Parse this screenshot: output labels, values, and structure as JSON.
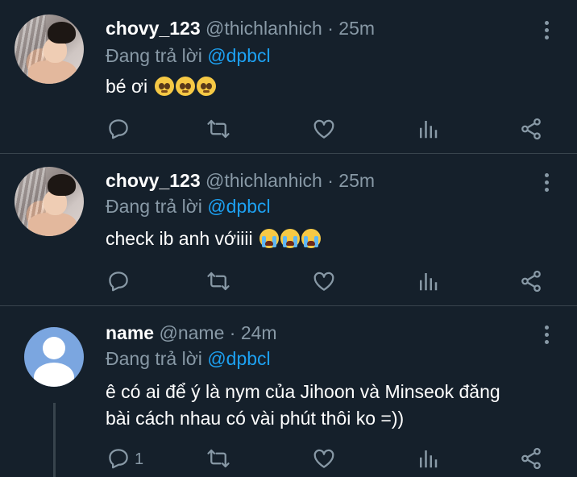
{
  "tweets": [
    {
      "name": "chovy_123",
      "handle": "@thichlanhich",
      "time": "· 25m",
      "reply_prefix": "Đang trả lời",
      "reply_to": "@dpbcl",
      "text": "bé ơi",
      "emoji": [
        "pleading-face",
        "pleading-face",
        "pleading-face"
      ],
      "reply_count": ""
    },
    {
      "name": "chovy_123",
      "handle": "@thichlanhich",
      "time": "· 25m",
      "reply_prefix": "Đang trả lời",
      "reply_to": "@dpbcl",
      "text": "check ib anh vớiiii",
      "emoji": [
        "loudly-crying-face",
        "loudly-crying-face",
        "loudly-crying-face"
      ],
      "reply_count": ""
    },
    {
      "name": "name",
      "handle": "@name",
      "time": "· 24m",
      "reply_prefix": "Đang trả lời",
      "reply_to": "@dpbcl",
      "text_line1": "ê có ai để ý là nym của Jihoon và Minseok đăng",
      "text_line2": "bài cách nhau có vài phút thôi ko =))",
      "reply_count": "1"
    }
  ],
  "icons": {
    "reply": "reply-icon",
    "retweet": "retweet-icon",
    "like": "heart-icon",
    "analytics": "analytics-icon",
    "share": "share-icon",
    "more": "more-vertical-icon"
  },
  "colors": {
    "background": "#15202b",
    "secondary_text": "#8899a6",
    "accent": "#1da1f2",
    "divider": "#38444d"
  }
}
